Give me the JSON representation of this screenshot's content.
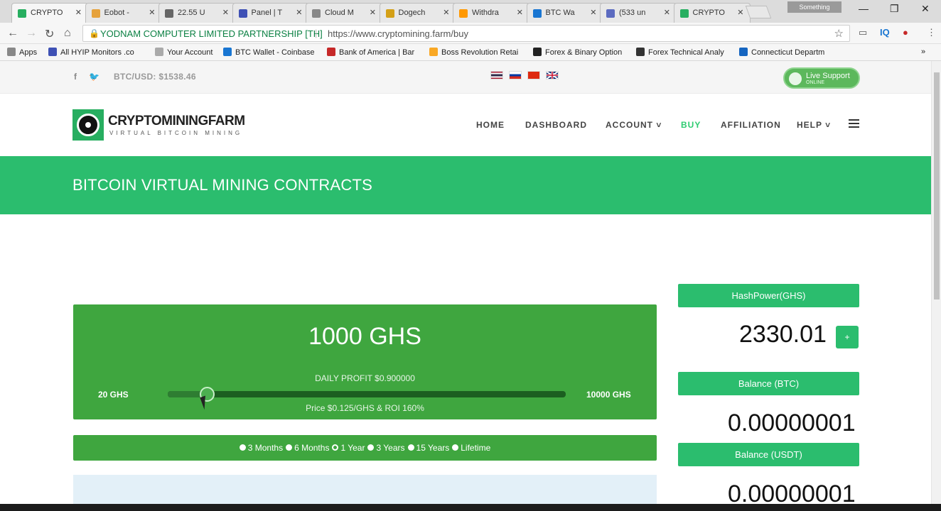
{
  "browser": {
    "tabs": [
      {
        "label": "CRYPTO",
        "active": true,
        "color": "#27ae60"
      },
      {
        "label": "Eobot -",
        "active": false,
        "color": "#e6a23c"
      },
      {
        "label": "22.55 U",
        "active": false,
        "color": "#666666"
      },
      {
        "label": "Panel | T",
        "active": false,
        "color": "#3f51b5"
      },
      {
        "label": "Cloud M",
        "active": false,
        "color": "#888888"
      },
      {
        "label": "Dogech",
        "active": false,
        "color": "#d4a017"
      },
      {
        "label": "Withdra",
        "active": false,
        "color": "#ff9800"
      },
      {
        "label": "BTC Wa",
        "active": false,
        "color": "#1976d2"
      },
      {
        "label": "(533 un",
        "active": false,
        "color": "#5c6bc0"
      },
      {
        "label": "CRYPTO",
        "active": false,
        "color": "#27ae60"
      }
    ],
    "profile_label": "Something",
    "cert_name": "YODNAM COMPUTER LIMITED PARTNERSHIP [TH]",
    "url": "https://www.cryptomining.farm/buy",
    "bookmarks": [
      {
        "label": "Apps",
        "color": "#888888"
      },
      {
        "label": "All HYIP Monitors .co",
        "color": "#3f51b5"
      },
      {
        "label": "Your Account",
        "color": "#aaaaaa"
      },
      {
        "label": "BTC Wallet - Coinbase",
        "color": "#1976d2"
      },
      {
        "label": "Bank of America | Bar",
        "color": "#c62828"
      },
      {
        "label": "Boss Revolution Retai",
        "color": "#f9a825"
      },
      {
        "label": "Forex & Binary Option",
        "color": "#222222"
      },
      {
        "label": "Forex Technical Analy",
        "color": "#333333"
      },
      {
        "label": "Connecticut Departm",
        "color": "#1565c0"
      }
    ]
  },
  "site": {
    "btc_usd": "BTC/USD: $1538.46",
    "live_support": "Live Support",
    "live_support_sub": "ONLINE",
    "logo_name": "CRYPTOMININGFARM",
    "logo_tag": "VIRTUAL BITCOIN MINING",
    "nav": [
      {
        "label": "HOME",
        "active": false
      },
      {
        "label": "DASHBOARD",
        "active": false
      },
      {
        "label": "ACCOUNT ˅",
        "active": false
      },
      {
        "label": "BUY",
        "active": true
      },
      {
        "label": "AFFILIATION",
        "active": false
      },
      {
        "label": "HELP ˅",
        "active": false
      }
    ],
    "banner_title": "BITCOIN VIRTUAL MINING CONTRACTS"
  },
  "buy": {
    "ghs_value": "1000 GHS",
    "daily_profit": "DAILY PROFIT $0.900000",
    "min_label": "20 GHS",
    "max_label": "10000 GHS",
    "price_roi": "Price $0.125/GHS & ROI 160%",
    "slider_fraction": 0.098,
    "periods": [
      {
        "label": "3 Months",
        "checked": false
      },
      {
        "label": "6 Months",
        "checked": false
      },
      {
        "label": "1 Year",
        "checked": true
      },
      {
        "label": "3 Years",
        "checked": false
      },
      {
        "label": "15 Years",
        "checked": false
      },
      {
        "label": "Lifetime",
        "checked": false
      }
    ]
  },
  "sidebar": {
    "hashpower_label": "HashPower(GHS)",
    "hashpower_value": "2330.01",
    "plus_label": "+",
    "balance_btc_label": "Balance (BTC)",
    "balance_btc_value": "0.00000001",
    "balance_usdt_label": "Balance (USDT)",
    "balance_usdt_value": "0.00000001"
  },
  "colors": {
    "accent": "#2bbd6e",
    "box_green": "#3fa63f"
  }
}
